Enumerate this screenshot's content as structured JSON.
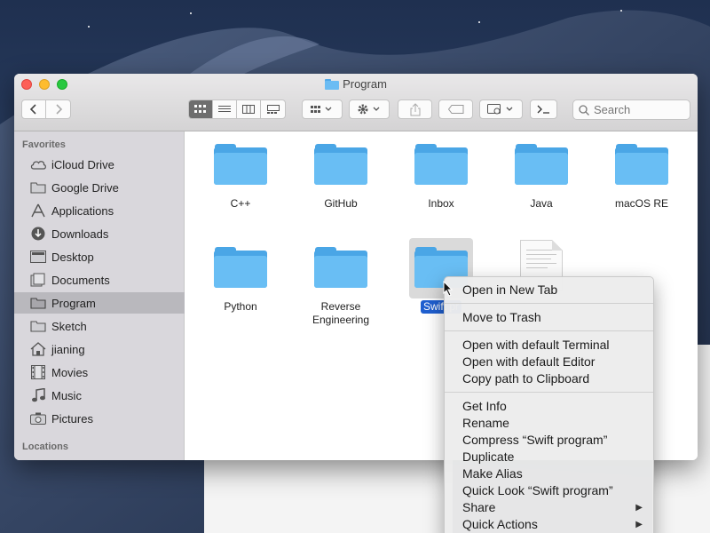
{
  "window": {
    "title": "Program"
  },
  "toolbar": {
    "back_icon": "chevron-left-icon",
    "forward_icon": "chevron-right-icon",
    "view_modes": [
      "icon-view-icon",
      "list-view-icon",
      "column-view-icon",
      "gallery-view-icon"
    ],
    "active_view": 0,
    "search": {
      "placeholder": "Search",
      "value": ""
    }
  },
  "sidebar": {
    "favorites_heading": "Favorites",
    "locations_heading": "Locations",
    "items": [
      {
        "label": "iCloud Drive",
        "icon": "cloud-icon"
      },
      {
        "label": "Google Drive",
        "icon": "folder-icon"
      },
      {
        "label": "Applications",
        "icon": "applications-icon"
      },
      {
        "label": "Downloads",
        "icon": "download-icon"
      },
      {
        "label": "Desktop",
        "icon": "desktop-icon"
      },
      {
        "label": "Documents",
        "icon": "document-icon"
      },
      {
        "label": "Program",
        "icon": "folder-icon",
        "selected": true
      },
      {
        "label": "Sketch",
        "icon": "folder-icon"
      },
      {
        "label": "jianing",
        "icon": "home-icon"
      },
      {
        "label": "Movies",
        "icon": "film-icon"
      },
      {
        "label": "Music",
        "icon": "music-icon"
      },
      {
        "label": "Pictures",
        "icon": "camera-icon"
      }
    ]
  },
  "content": {
    "items": [
      {
        "label": "C++",
        "kind": "folder"
      },
      {
        "label": "GitHub",
        "kind": "folder"
      },
      {
        "label": "Inbox",
        "kind": "folder"
      },
      {
        "label": "Java",
        "kind": "folder"
      },
      {
        "label": "macOS RE",
        "kind": "folder"
      },
      {
        "label": "Python",
        "kind": "folder"
      },
      {
        "label": "Reverse Engineering",
        "kind": "folder"
      },
      {
        "label": "Swift pr",
        "kind": "folder",
        "selected": true
      },
      {
        "label": "",
        "kind": "document"
      }
    ]
  },
  "context_menu": {
    "groups": [
      [
        "Open in New Tab"
      ],
      [
        "Move to Trash"
      ],
      [
        "Open with default Terminal",
        "Open with default Editor",
        "Copy path to Clipboard"
      ],
      [
        "Get Info",
        "Rename",
        "Compress “Swift program”",
        "Duplicate",
        "Make Alias",
        "Quick Look “Swift program”",
        "Share",
        "Quick Actions"
      ]
    ],
    "submenu_items": [
      "Share",
      "Quick Actions"
    ]
  }
}
